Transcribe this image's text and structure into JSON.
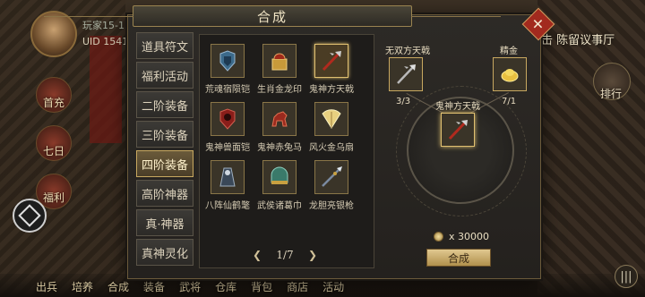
{
  "profile": {
    "name": "玩家15-1",
    "uid": "UID 15412"
  },
  "side_buttons": [
    "首充",
    "七日",
    "福利"
  ],
  "header_right": "击 陈留议事厅",
  "rank_label": "排行",
  "bottom_nav": [
    "出兵",
    "培养",
    "合成",
    "装备",
    "武将",
    "仓库",
    "背包",
    "商店",
    "活动"
  ],
  "dialog": {
    "title": "合成",
    "categories": [
      {
        "label": "道具符文",
        "active": false
      },
      {
        "label": "福利活动",
        "active": false
      },
      {
        "label": "二阶装备",
        "active": false
      },
      {
        "label": "三阶装备",
        "active": false
      },
      {
        "label": "四阶装备",
        "active": true
      },
      {
        "label": "高阶神器",
        "active": false
      },
      {
        "label": "真·神器",
        "active": false
      },
      {
        "label": "真神灵化",
        "active": false
      }
    ],
    "items": [
      {
        "label": "荒魂宿陨铠",
        "icon": "armor-icon",
        "selected": false
      },
      {
        "label": "生肖金龙印",
        "icon": "seal-icon",
        "selected": false
      },
      {
        "label": "鬼神方天戟",
        "icon": "halberd-icon",
        "selected": true
      },
      {
        "label": "鬼神兽面铠",
        "icon": "armor-icon",
        "selected": false
      },
      {
        "label": "鬼神赤兔马",
        "icon": "horse-icon",
        "selected": false
      },
      {
        "label": "风火金乌扇",
        "icon": "fan-icon",
        "selected": false
      },
      {
        "label": "八阵仙鹤氅",
        "icon": "cloak-icon",
        "selected": false
      },
      {
        "label": "武侯诸葛巾",
        "icon": "hat-icon",
        "selected": false
      },
      {
        "label": "龙胆亮银枪",
        "icon": "spear-icon",
        "selected": false
      }
    ],
    "pager": {
      "text": "1/7",
      "prev": "❮",
      "next": "❯"
    },
    "compose": {
      "target": "鬼神方天戟",
      "materials": [
        {
          "label": "无双方天戟",
          "count": "3/3",
          "icon": "halberd-icon"
        },
        {
          "label": "精金",
          "count": "7/1",
          "icon": "gold-ingot-icon"
        }
      ],
      "cost": "x 30000",
      "button_label": "合成"
    },
    "close": "✕"
  },
  "colors": {
    "accent_gold": "#c8a860",
    "close_red": "#a22a1e",
    "active_tab": "#6a5a3a"
  }
}
